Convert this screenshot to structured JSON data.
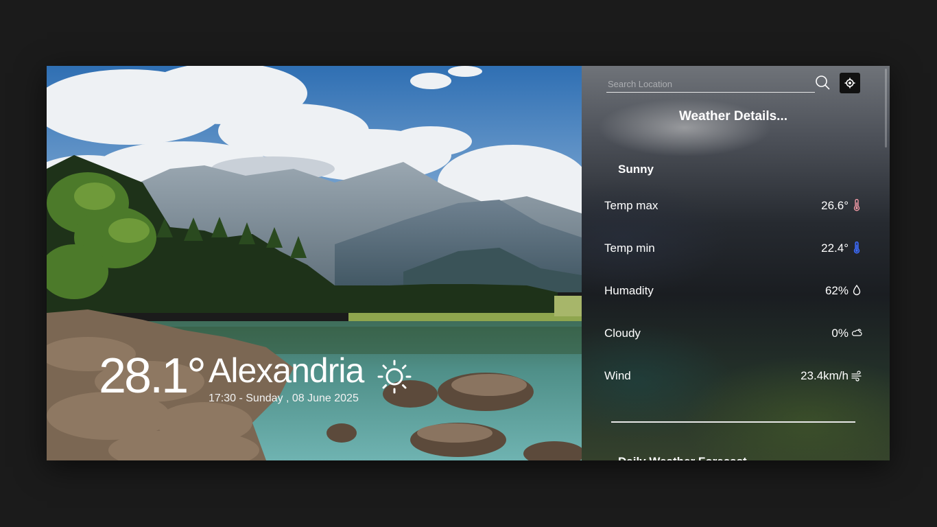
{
  "current": {
    "temperature": "28.1°",
    "city": "Alexandria",
    "datetime": "17:30 - Sunday , 08 June 2025",
    "icon": "sun-icon"
  },
  "search": {
    "placeholder": "Search Location",
    "search_icon": "search-icon",
    "locate_icon": "crosshair-location-icon"
  },
  "details": {
    "title": "Weather Details...",
    "condition": "Sunny",
    "rows": [
      {
        "label": "Temp max",
        "value": "26.6°",
        "icon": "thermometer-hot-icon",
        "icon_color": "#f29aa6"
      },
      {
        "label": "Temp min",
        "value": "22.4°",
        "icon": "thermometer-cold-icon",
        "icon_color": "#3d6cff"
      },
      {
        "label": "Humadity",
        "value": "62%",
        "icon": "droplet-icon",
        "icon_color": "#ffffff"
      },
      {
        "label": "Cloudy",
        "value": "0%",
        "icon": "cloud-sun-icon",
        "icon_color": "#ffffff"
      },
      {
        "label": "Wind",
        "value": "23.4km/h",
        "icon": "wind-icon",
        "icon_color": "#ffffff"
      }
    ]
  },
  "forecast": {
    "title": "Daily Weather Forecast"
  },
  "colors": {
    "page_background": "#1b1b1b",
    "text": "#ffffff",
    "locate_button": "#111111"
  }
}
